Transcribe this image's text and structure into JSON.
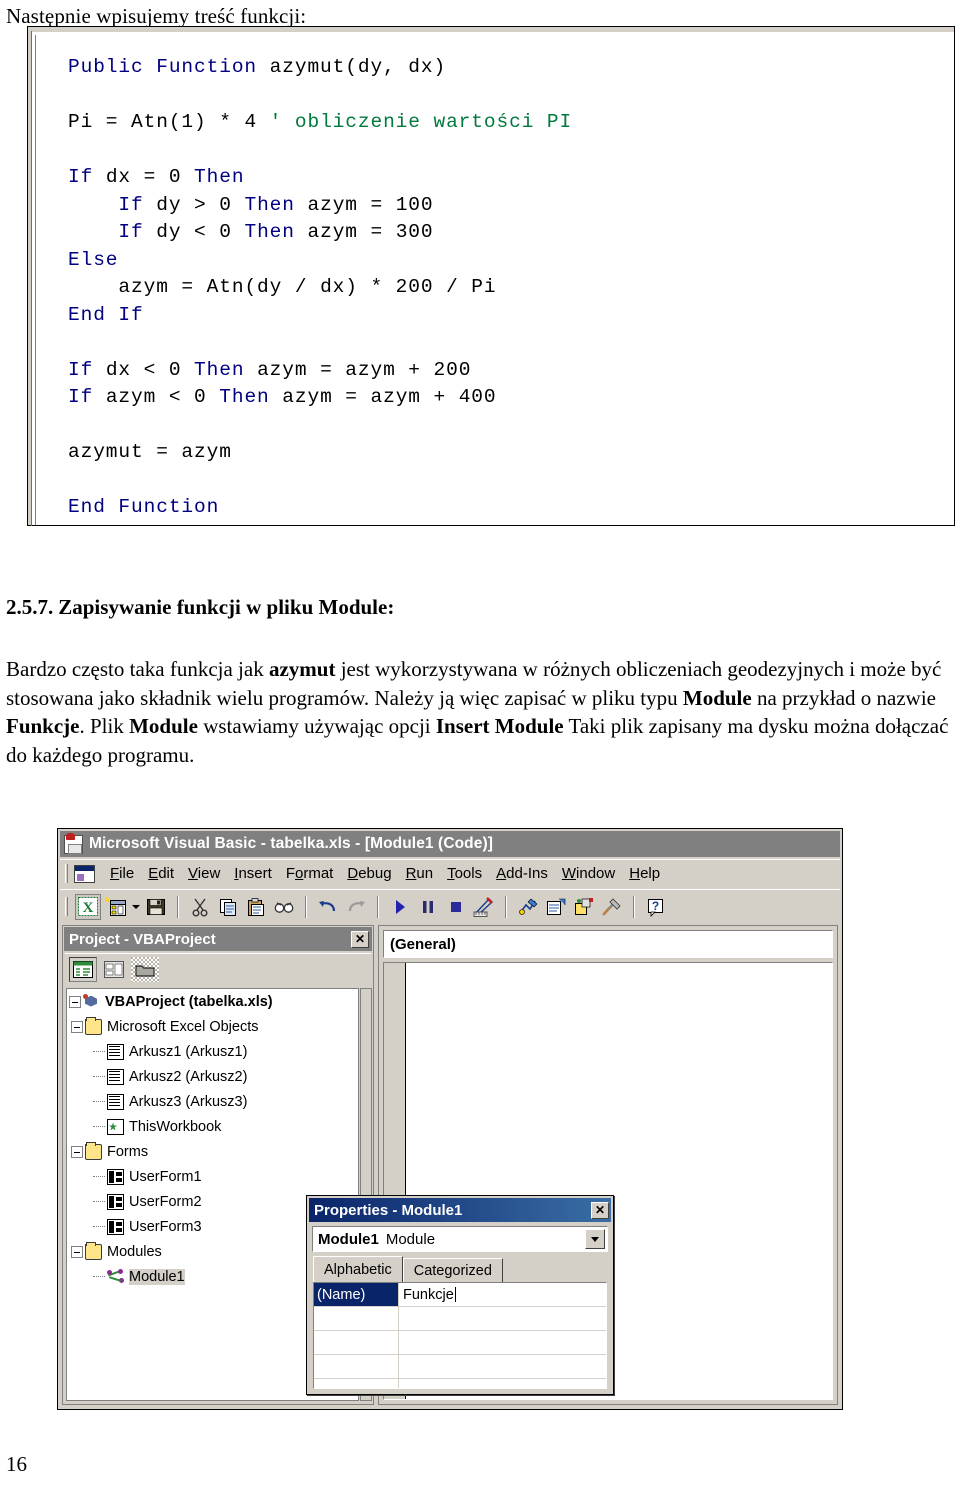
{
  "document": {
    "intro_line": "Następnie wpisujemy treść funkcji:",
    "page_number": "16"
  },
  "code_figure": {
    "lines": [
      {
        "indent": 0,
        "segments": [
          {
            "t": "Public Function ",
            "c": "kw"
          },
          {
            "t": "azymut(dy, dx)",
            "c": "plain"
          }
        ]
      },
      {
        "indent": 0,
        "segments": []
      },
      {
        "indent": 0,
        "segments": [
          {
            "t": "Pi = ",
            "c": "plain"
          },
          {
            "t": "Atn",
            "c": "plain"
          },
          {
            "t": "(1) * 4 ",
            "c": "plain"
          },
          {
            "t": "' obliczenie wartości PI",
            "c": "cmt"
          }
        ]
      },
      {
        "indent": 0,
        "segments": []
      },
      {
        "indent": 0,
        "segments": [
          {
            "t": "If",
            "c": "kw"
          },
          {
            "t": " dx = 0 ",
            "c": "plain"
          },
          {
            "t": "Then",
            "c": "kw"
          }
        ]
      },
      {
        "indent": 1,
        "segments": [
          {
            "t": "If",
            "c": "kw"
          },
          {
            "t": " dy > 0 ",
            "c": "plain"
          },
          {
            "t": "Then",
            "c": "kw"
          },
          {
            "t": " azym = 100",
            "c": "plain"
          }
        ]
      },
      {
        "indent": 1,
        "segments": [
          {
            "t": "If",
            "c": "kw"
          },
          {
            "t": " dy < 0 ",
            "c": "plain"
          },
          {
            "t": "Then",
            "c": "kw"
          },
          {
            "t": " azym = 300",
            "c": "plain"
          }
        ]
      },
      {
        "indent": 0,
        "segments": [
          {
            "t": "Else",
            "c": "kw"
          }
        ]
      },
      {
        "indent": 1,
        "segments": [
          {
            "t": "azym = ",
            "c": "plain"
          },
          {
            "t": "Atn",
            "c": "plain"
          },
          {
            "t": "(dy / dx) * 200 / Pi",
            "c": "plain"
          }
        ]
      },
      {
        "indent": 0,
        "segments": [
          {
            "t": "End If",
            "c": "kw"
          }
        ]
      },
      {
        "indent": 0,
        "segments": []
      },
      {
        "indent": 0,
        "segments": [
          {
            "t": "If",
            "c": "kw"
          },
          {
            "t": " dx < 0 ",
            "c": "plain"
          },
          {
            "t": "Then",
            "c": "kw"
          },
          {
            "t": " azym = azym + 200",
            "c": "plain"
          }
        ]
      },
      {
        "indent": 0,
        "segments": [
          {
            "t": "If",
            "c": "kw"
          },
          {
            "t": " azym < 0 ",
            "c": "plain"
          },
          {
            "t": "Then",
            "c": "kw"
          },
          {
            "t": " azym = azym + 400",
            "c": "plain"
          }
        ]
      },
      {
        "indent": 0,
        "segments": []
      },
      {
        "indent": 0,
        "segments": [
          {
            "t": "azymut = azym",
            "c": "plain"
          }
        ]
      },
      {
        "indent": 0,
        "segments": []
      },
      {
        "indent": 0,
        "segments": [
          {
            "t": "End Function",
            "c": "kw"
          }
        ]
      }
    ]
  },
  "section": {
    "number": "2.5.7.",
    "heading": "Zapisywanie funkcji w pliku Module:",
    "paragraph_runs": [
      {
        "t": "Bardzo często taka funkcja jak ",
        "b": false
      },
      {
        "t": "azymut",
        "b": true
      },
      {
        "t": " jest wykorzystywana w różnych obliczeniach geodezyjnych i może być stosowana jako składnik wielu programów. Należy ją więc zapisać w pliku typu ",
        "b": false
      },
      {
        "t": "Module",
        "b": true
      },
      {
        "t": " na przykład o nazwie ",
        "b": false
      },
      {
        "t": "Funkcje",
        "b": true
      },
      {
        "t": ". Plik ",
        "b": false
      },
      {
        "t": "Module",
        "b": true
      },
      {
        "t": " wstawiamy używając opcji ",
        "b": false
      },
      {
        "t": "Insert Module",
        "b": true
      },
      {
        "t": " Taki plik zapisany ma dysku można dołączać do każdego programu.",
        "b": false
      }
    ]
  },
  "vbe": {
    "title": "Microsoft Visual Basic - tabelka.xls - [Module1 (Code)]",
    "menu": [
      {
        "label": "File",
        "accel": "F"
      },
      {
        "label": "Edit",
        "accel": "E"
      },
      {
        "label": "View",
        "accel": "V"
      },
      {
        "label": "Insert",
        "accel": "I"
      },
      {
        "label": "Format",
        "accel": "o"
      },
      {
        "label": "Debug",
        "accel": "D"
      },
      {
        "label": "Run",
        "accel": "R"
      },
      {
        "label": "Tools",
        "accel": "T"
      },
      {
        "label": "Add-Ins",
        "accel": "A"
      },
      {
        "label": "Window",
        "accel": "W"
      },
      {
        "label": "Help",
        "accel": "H"
      }
    ],
    "toolbar_icons": [
      "view-excel-icon",
      "insert-userform-icon",
      "insert-dropdown-icon",
      "save-icon",
      "cut-icon",
      "copy-icon",
      "paste-icon",
      "find-icon",
      "undo-icon",
      "redo-icon",
      "run-icon",
      "break-icon",
      "reset-icon",
      "design-mode-icon",
      "project-explorer-icon",
      "properties-window-icon",
      "object-browser-icon",
      "toolbox-icon",
      "help-icon"
    ],
    "project_explorer": {
      "title": "Project - VBAProject",
      "close_label": "✕",
      "toolbar_icons": [
        "view-code-icon",
        "view-object-icon",
        "toggle-folders-icon"
      ],
      "tree": [
        {
          "level": 0,
          "icon": "vbaproject-icon",
          "label": "VBAProject (tabelka.xls)",
          "bold": true,
          "expander": true,
          "selected": false
        },
        {
          "level": 1,
          "icon": "folder-icon",
          "label": "Microsoft Excel Objects",
          "bold": false,
          "expander": true,
          "selected": false
        },
        {
          "level": 2,
          "icon": "sheet-icon",
          "label": "Arkusz1 (Arkusz1)",
          "bold": false,
          "expander": false,
          "selected": false
        },
        {
          "level": 2,
          "icon": "sheet-icon",
          "label": "Arkusz2 (Arkusz2)",
          "bold": false,
          "expander": false,
          "selected": false
        },
        {
          "level": 2,
          "icon": "sheet-icon",
          "label": "Arkusz3 (Arkusz3)",
          "bold": false,
          "expander": false,
          "selected": false
        },
        {
          "level": 2,
          "icon": "workbook-icon",
          "label": "ThisWorkbook",
          "bold": false,
          "expander": false,
          "selected": false
        },
        {
          "level": 1,
          "icon": "folder-icon",
          "label": "Forms",
          "bold": false,
          "expander": true,
          "selected": false
        },
        {
          "level": 2,
          "icon": "userform-icon",
          "label": "UserForm1",
          "bold": false,
          "expander": false,
          "selected": false
        },
        {
          "level": 2,
          "icon": "userform-icon",
          "label": "UserForm2",
          "bold": false,
          "expander": false,
          "selected": false
        },
        {
          "level": 2,
          "icon": "userform-icon",
          "label": "UserForm3",
          "bold": false,
          "expander": false,
          "selected": false
        },
        {
          "level": 1,
          "icon": "folder-icon",
          "label": "Modules",
          "bold": false,
          "expander": true,
          "selected": false
        },
        {
          "level": 2,
          "icon": "module-icon",
          "label": "Module1",
          "bold": false,
          "expander": false,
          "selected": true
        }
      ]
    },
    "code_window": {
      "object_combo": "(General)",
      "procedure_combo": "",
      "content": ""
    },
    "properties_window": {
      "title": "Properties - Module1",
      "close_label": "✕",
      "object_name": "Module1",
      "object_type": "Module",
      "tabs": [
        {
          "label": "Alphabetic",
          "active": true
        },
        {
          "label": "Categorized",
          "active": false
        }
      ],
      "rows": [
        {
          "key": "(Name)",
          "value": "Funkcje",
          "editing": true
        }
      ]
    }
  },
  "colors": {
    "vb_keyword": "#000080",
    "vb_comment": "#007a3d",
    "window_face": "#d4d0c8",
    "titlebar_inactive": "#808080",
    "titlebar_active": "#0a246a",
    "selection": "#0a246a"
  }
}
